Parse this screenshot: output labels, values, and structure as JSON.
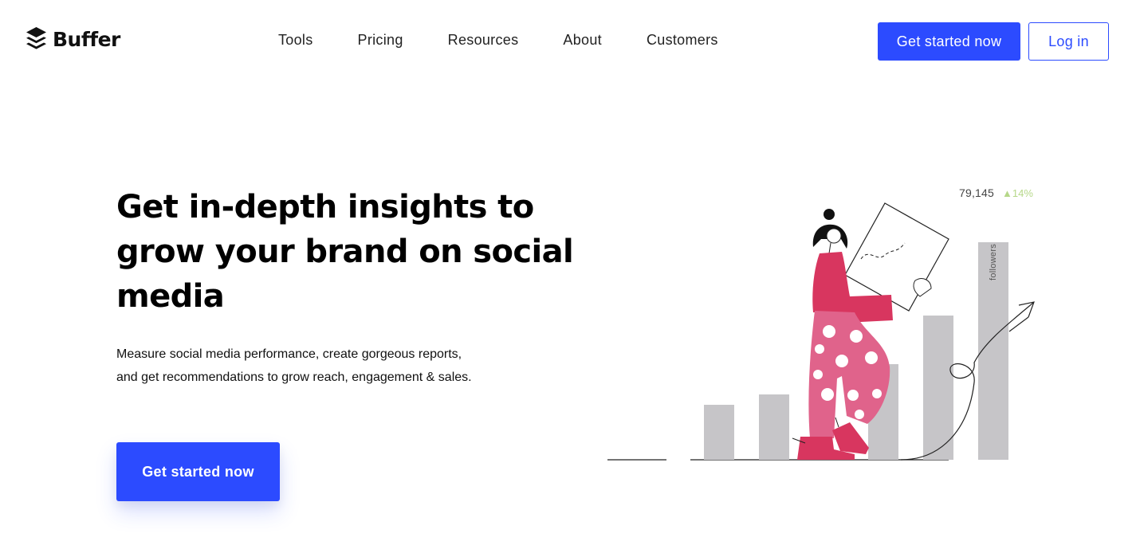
{
  "brand": {
    "name": "Buffer",
    "accent": "#2c4bff"
  },
  "nav": {
    "items": [
      "Tools",
      "Pricing",
      "Resources",
      "About",
      "Customers"
    ]
  },
  "header_actions": {
    "cta_label": "Get started now",
    "login_label": "Log in"
  },
  "hero": {
    "title": "Get in-depth insights to grow your brand on social media",
    "subtitle": "Measure social media performance, create gorgeous reports, and get recommendations to grow reach, engagement & sales.",
    "cta_label": "Get started now"
  },
  "illustration": {
    "stat_value": "79,145",
    "stat_change": "▲14%",
    "bar_label": "followers",
    "colors": {
      "bars": "#c6c5c8",
      "pink": "#e0638b",
      "magenta": "#d8365f",
      "dots": "#ffffff",
      "up": "#b6d889"
    }
  }
}
